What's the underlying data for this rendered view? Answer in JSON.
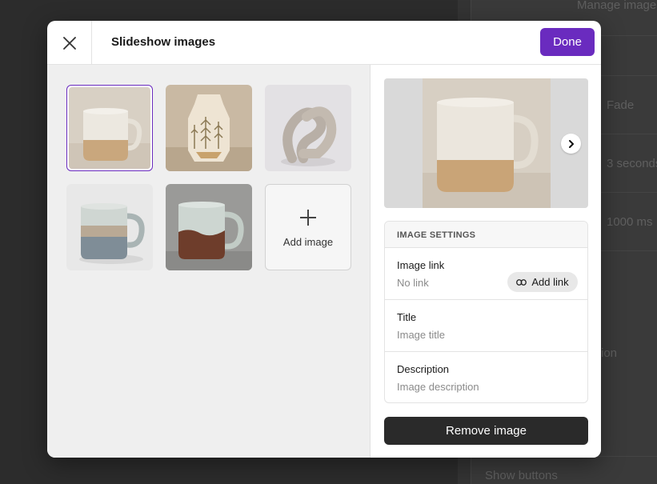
{
  "background": {
    "header_text": "Manage images",
    "transition_value": "Fade",
    "duration_value": "3 seconds",
    "speed_value": "1000 ms",
    "partial_label": "ion",
    "show_buttons_label": "Show buttons"
  },
  "modal": {
    "title": "Slideshow images",
    "done_label": "Done",
    "add_image_label": "Add image",
    "thumbnails": [
      {
        "name": "white-mug",
        "selected": true
      },
      {
        "name": "leaf-vase",
        "selected": false
      },
      {
        "name": "knot-sculpture",
        "selected": false
      },
      {
        "name": "grey-blue-mug",
        "selected": false
      },
      {
        "name": "brown-glaze-mug",
        "selected": false
      }
    ],
    "settings": {
      "heading": "IMAGE SETTINGS",
      "link_label": "Image link",
      "link_value": "No link",
      "add_link_label": "Add link",
      "title_label": "Title",
      "title_placeholder": "Image title",
      "description_label": "Description",
      "description_placeholder": "Image description"
    },
    "remove_label": "Remove image"
  },
  "colors": {
    "accent": "#6a2bbf",
    "dark_button": "#2a2a2a"
  }
}
